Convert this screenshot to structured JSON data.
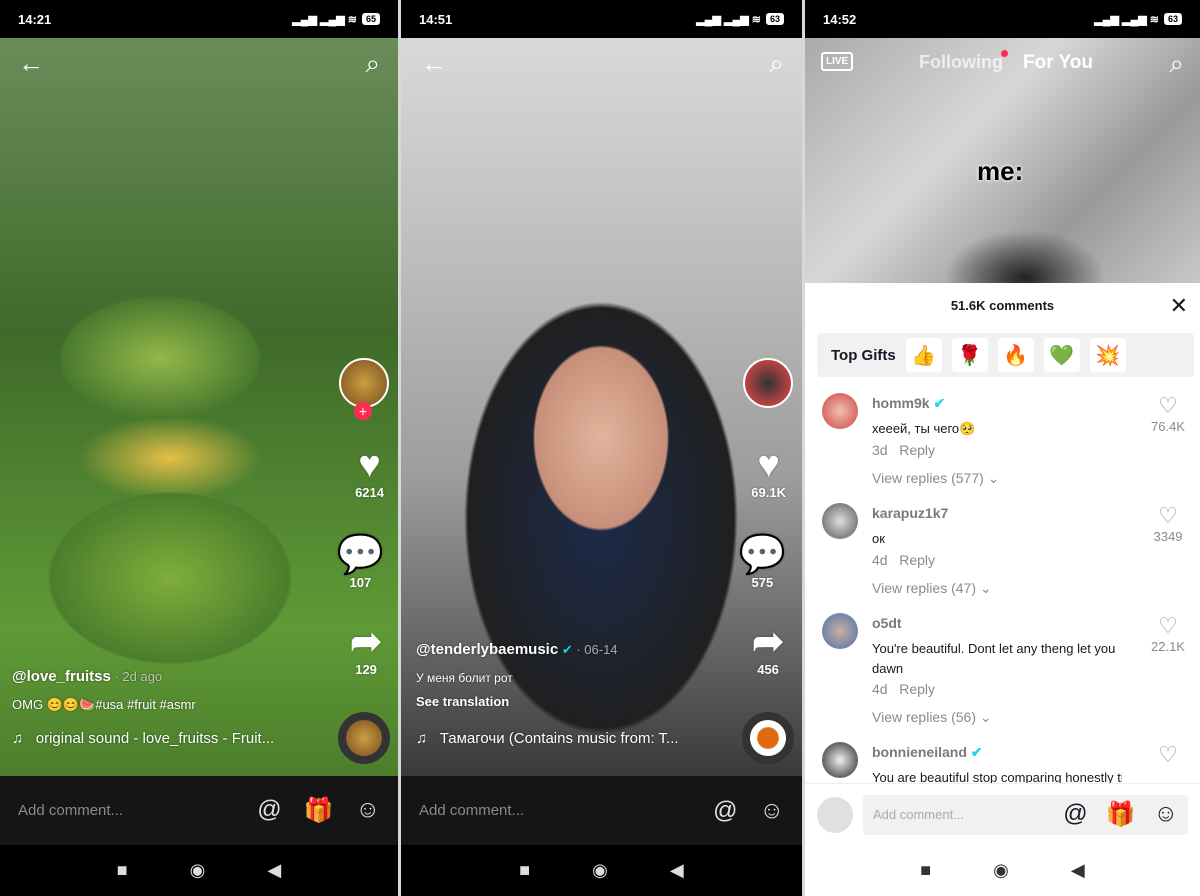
{
  "panels": [
    {
      "time": "14:21",
      "battery": "65",
      "likes": "6214",
      "comments": "107",
      "shares": "129",
      "username": "@love_fruitss",
      "when": "2d ago",
      "caption": "OMG 😊😊🍉#usa #fruit #asmr",
      "sound": "original sound - love_fruitss - Fruit...",
      "comment_placeholder": "Add comment..."
    },
    {
      "time": "14:51",
      "battery": "63",
      "likes": "69.1K",
      "comments": "575",
      "shares": "456",
      "username": "@tenderlybaemusic",
      "when": "06-14",
      "caption": "У меня болит рот",
      "see_translation": "See translation",
      "sound": "Тамагочи (Contains music from: T...",
      "comment_placeholder": "Add comment..."
    },
    {
      "time": "14:52",
      "battery": "63",
      "live": "LIVE",
      "tab_following": "Following",
      "tab_foryou": "For You",
      "overlay_text": "me:",
      "comment_count": "51.6K comments",
      "top_gifts": "Top Gifts",
      "gifts": [
        "👍",
        "🌹",
        "🔥",
        "💚",
        "💥"
      ],
      "comments": [
        {
          "user": "homm9k",
          "verified": true,
          "text": "хееей, ты чего🥺",
          "age": "3d",
          "reply": "Reply",
          "likes": "76.4K",
          "view_replies": "View replies (577)"
        },
        {
          "user": "karapuz1k7",
          "verified": false,
          "text": "ок",
          "age": "4d",
          "reply": "Reply",
          "likes": "3349",
          "view_replies": "View replies (47)"
        },
        {
          "user": "o5dt",
          "verified": false,
          "text": "You're beautiful. Dont let any theng let you dawn",
          "age": "4d",
          "reply": "Reply",
          "likes": "22.1K",
          "view_replies": "View replies (56)"
        },
        {
          "user": "bonnieneiland",
          "verified": true,
          "text": "You are beautiful stop comparing honestly they"
        }
      ],
      "comment_placeholder": "Add comment..."
    }
  ]
}
